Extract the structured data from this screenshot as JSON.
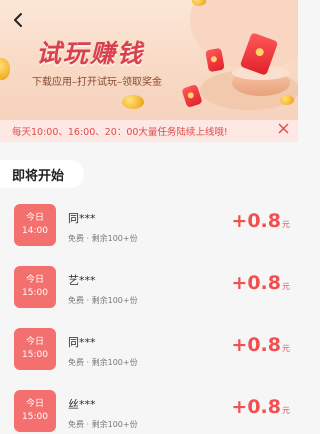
{
  "header": {
    "back_icon": "chevron-left-icon",
    "title": "试玩赚钱",
    "subtitle": "下载应用–打开试玩–领取奖金"
  },
  "notice": {
    "text": "每天10:00、16:00、20：00大量任务陆续上线哦!",
    "close_icon": "close-icon"
  },
  "section": {
    "title": "即将开始"
  },
  "tasks": [
    {
      "day": "今日",
      "time": "14:00",
      "name": "同***",
      "meta": "免费 · 剩余100+份",
      "amount": "+0.8",
      "unit": "元"
    },
    {
      "day": "今日",
      "time": "15:00",
      "name": "艺***",
      "meta": "免费 · 剩余100+份",
      "amount": "+0.8",
      "unit": "元"
    },
    {
      "day": "今日",
      "time": "15:00",
      "name": "同***",
      "meta": "免费 · 剩余100+份",
      "amount": "+0.8",
      "unit": "元"
    },
    {
      "day": "今日",
      "time": "15:00",
      "name": "丝***",
      "meta": "免费 · 剩余100+份",
      "amount": "+0.8",
      "unit": "元"
    }
  ],
  "colors": {
    "accent": "#f4706f",
    "reward": "#f0504f",
    "notice_bg": "#fde8e4",
    "title": "#d9414c"
  }
}
